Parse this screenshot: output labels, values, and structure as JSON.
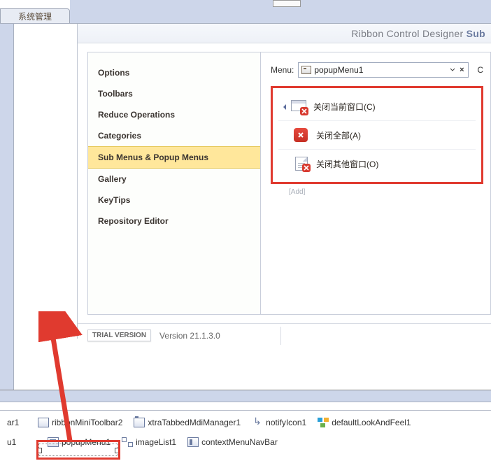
{
  "top_tab": "系统管理",
  "designer_title": "Ribbon Control Designer",
  "designer_title_sub": "Sub",
  "nav": {
    "items": [
      "Options",
      "Toolbars",
      "Reduce Operations",
      "Categories",
      "Sub Menus & Popup Menus",
      "Gallery",
      "KeyTips",
      "Repository Editor"
    ],
    "selected_index": 4
  },
  "menu_row": {
    "label": "Menu:",
    "value": "popupMenu1",
    "extra": "C"
  },
  "popup_items": [
    "关闭当前窗口(C)",
    "关闭全部(A)",
    "关闭其他窗口(O)"
  ],
  "add_label": "[Add]",
  "footer": {
    "trial": "TRIAL VERSION",
    "version": "Version 21.1.3.0"
  },
  "tray": {
    "row1_partial": "ar1",
    "row1": [
      "ribbonMiniToolbar2",
      "xtraTabbedMdiManager1",
      "notifyIcon1",
      "defaultLookAndFeel1"
    ],
    "row2_partial": "u1",
    "row2": [
      "popupMenu1",
      "imageList1",
      "contextMenuNavBar"
    ]
  }
}
